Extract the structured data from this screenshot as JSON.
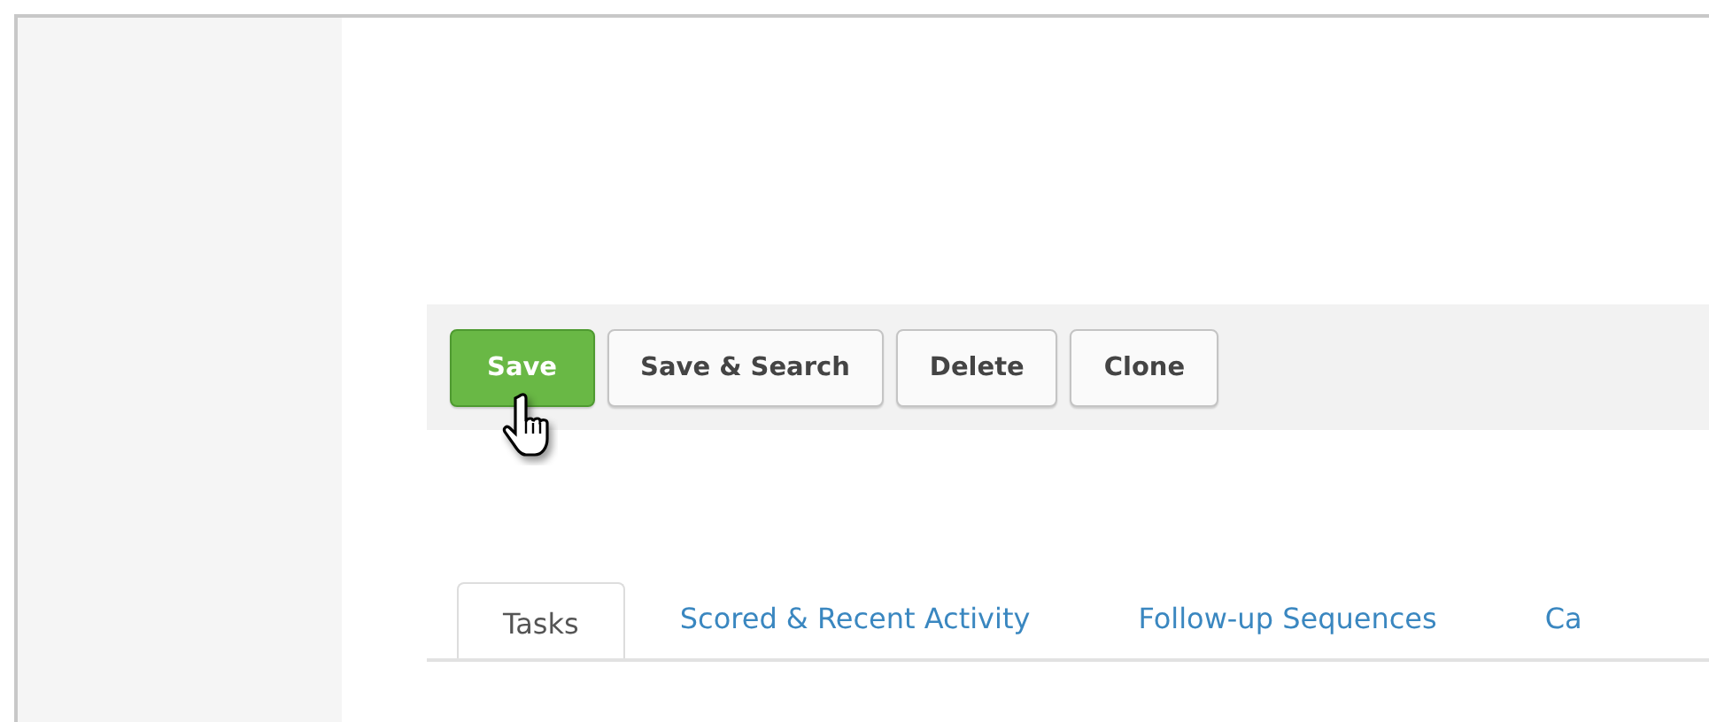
{
  "toolbar": {
    "buttons": [
      {
        "label": "Save",
        "kind": "primary"
      },
      {
        "label": "Save & Search",
        "kind": "default"
      },
      {
        "label": "Delete",
        "kind": "default"
      },
      {
        "label": "Clone",
        "kind": "default"
      }
    ]
  },
  "tabs": [
    {
      "label": "Tasks",
      "selected": true
    },
    {
      "label": "Scored & Recent Activity",
      "selected": false
    },
    {
      "label": "Follow-up Sequences",
      "selected": false
    },
    {
      "label": "Ca",
      "selected": false
    }
  ]
}
